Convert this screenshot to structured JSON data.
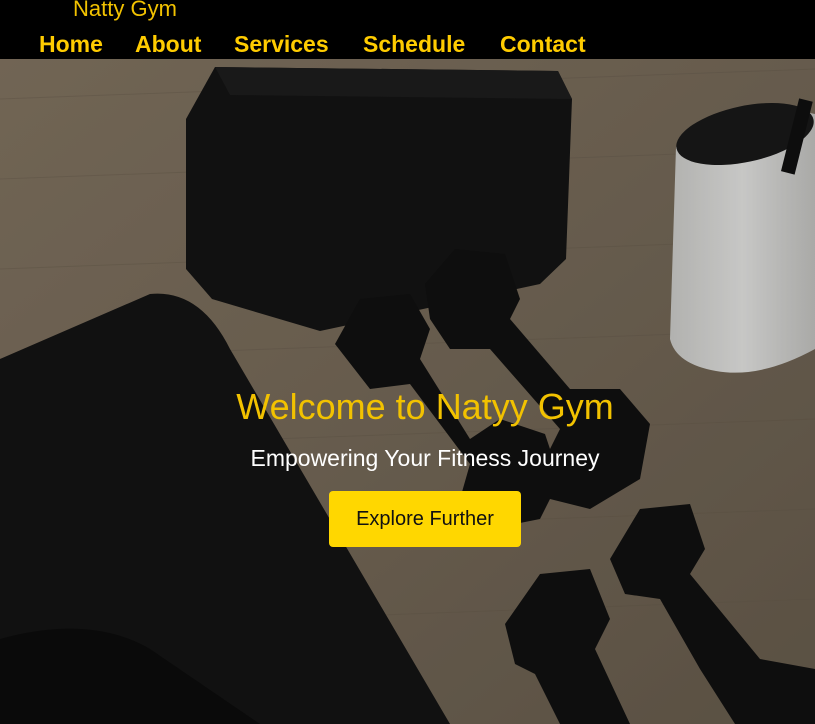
{
  "brand": {
    "name": "Natty Gym"
  },
  "nav": {
    "items": [
      {
        "label": "Home"
      },
      {
        "label": "About"
      },
      {
        "label": "Services"
      },
      {
        "label": "Schedule"
      },
      {
        "label": "Contact"
      }
    ]
  },
  "hero": {
    "title": "Welcome to Natyy Gym",
    "subtitle": "Empowering Your Fitness Journey",
    "cta_label": "Explore Further",
    "background_image": "gym-equipment-photo"
  },
  "colors": {
    "accent": "#ffcc00",
    "button": "#ffd700",
    "header_bg": "#000000"
  }
}
